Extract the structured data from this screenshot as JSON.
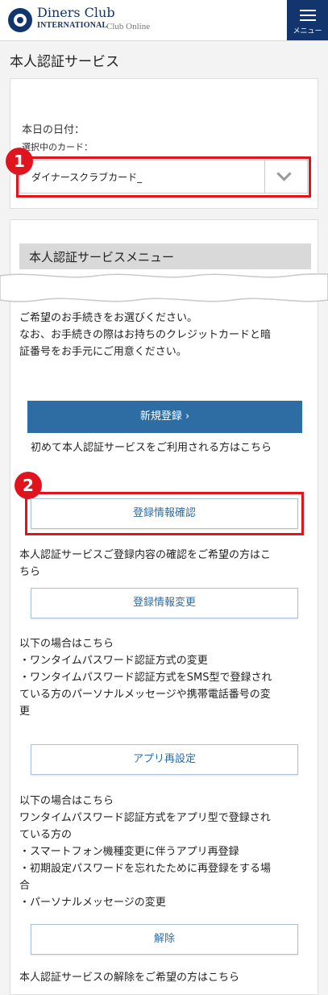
{
  "header": {
    "brand_name": "Diners Club",
    "brand_sub": "INTERNATIONAL",
    "brand_online": "Club Online",
    "menu_label": "メニュー"
  },
  "page_title": "本人認証サービス",
  "card_panel": {
    "date_label": "本日の日付：",
    "card_label": "選択中のカード：",
    "selected_card": "ダイナースクラブカード_"
  },
  "annotations": [
    "1",
    "2"
  ],
  "menu": {
    "heading": "本人認証サービスメニュー",
    "intro_lines": [
      "ご希望のお手続きをお選びください。",
      "なお、お手続きの際はお持ちのクレジットカードと暗",
      "証番号をお手元にご用意ください。"
    ],
    "new_registration": {
      "button": "新規登録 ›",
      "caption": "初めて本人認証サービスをご利用される方はこちら"
    },
    "confirm": {
      "button": "登録情報確認",
      "lines": [
        "本人認証サービスご登録内容の確認をご希望の方はこ",
        "ちら"
      ]
    },
    "change": {
      "button": "登録情報変更",
      "lines": [
        "以下の場合はこちら",
        "・ワンタイムパスワード認証方式の変更",
        "・ワンタイムパスワード認証方式をSMS型で登録され",
        "ている方のパーソナルメッセージや携帯電話番号の変",
        "更"
      ]
    },
    "app_reset": {
      "button": "アプリ再設定",
      "lines": [
        "以下の場合はこちら",
        "ワンタイムパスワード認証方式をアプリ型で登録され",
        "ている方の",
        "・スマートフォン機種変更に伴うアプリ再登録",
        "・初期設定パスワードを忘れたために再登録をする場",
        "合",
        "・パーソナルメッセージの変更"
      ]
    },
    "cancel": {
      "button": "解除",
      "caption": "本人認証サービスの解除をご希望の方はこちら"
    }
  },
  "colors": {
    "brand": "#13356e",
    "primary": "#2e6da4",
    "annotation": "#e0141e"
  }
}
